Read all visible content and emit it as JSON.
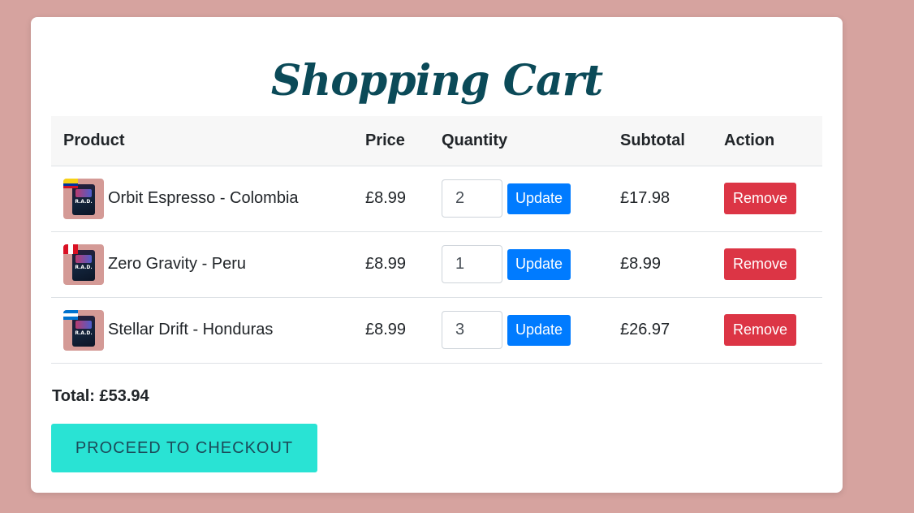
{
  "page": {
    "title": "Shopping Cart"
  },
  "table": {
    "headers": [
      "Product",
      "Price",
      "Quantity",
      "Subtotal",
      "Action"
    ],
    "rows": [
      {
        "product": "Orbit Espresso - Colombia",
        "price": "£8.99",
        "quantity": "2",
        "update_label": "Update",
        "subtotal": "£17.98",
        "remove_label": "Remove",
        "flag": "colombia-flag-icon"
      },
      {
        "product": "Zero Gravity - Peru",
        "price": "£8.99",
        "quantity": "1",
        "update_label": "Update",
        "subtotal": "£8.99",
        "remove_label": "Remove",
        "flag": "peru-flag-icon"
      },
      {
        "product": "Stellar Drift - Honduras",
        "price": "£8.99",
        "quantity": "3",
        "update_label": "Update",
        "subtotal": "£26.97",
        "remove_label": "Remove",
        "flag": "honduras-flag-icon"
      }
    ]
  },
  "product_image_label": "R.A.D.",
  "total_label": "Total: £53.94",
  "checkout_label": "PROCEED TO CHECKOUT",
  "colors": {
    "background": "#d6a39f",
    "title": "#0b4a58",
    "update_button": "#007bff",
    "remove_button": "#dc3545",
    "checkout_button": "#29e3d4"
  }
}
